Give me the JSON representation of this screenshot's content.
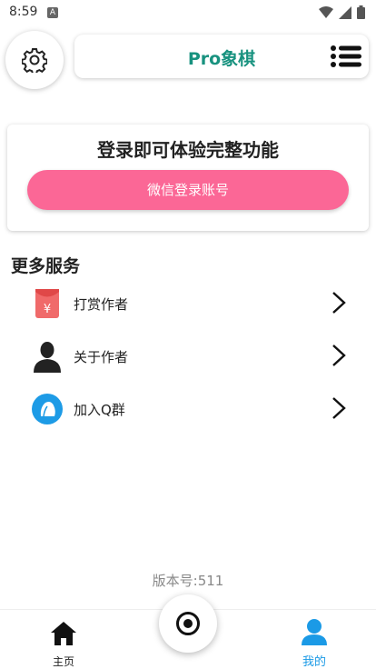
{
  "status_bar": {
    "time": "8:59",
    "notification_badge": "A"
  },
  "header": {
    "title": "Pro象棋"
  },
  "login_card": {
    "heading": "登录即可体验完整功能",
    "button_label": "微信登录账号"
  },
  "services": {
    "section_title": "更多服务",
    "items": [
      {
        "label": "打赏作者",
        "icon": "red-envelope-icon"
      },
      {
        "label": "关于作者",
        "icon": "user-silhouette-icon"
      },
      {
        "label": "加入Q群",
        "icon": "qq-icon"
      }
    ]
  },
  "version_text": "版本号:511",
  "bottom_nav": {
    "home_label": "主页",
    "mine_label": "我的",
    "active": "mine"
  },
  "colors": {
    "accent_teal": "#18927f",
    "pink_button": "#fb6796",
    "active_blue": "#1b9ae6"
  }
}
